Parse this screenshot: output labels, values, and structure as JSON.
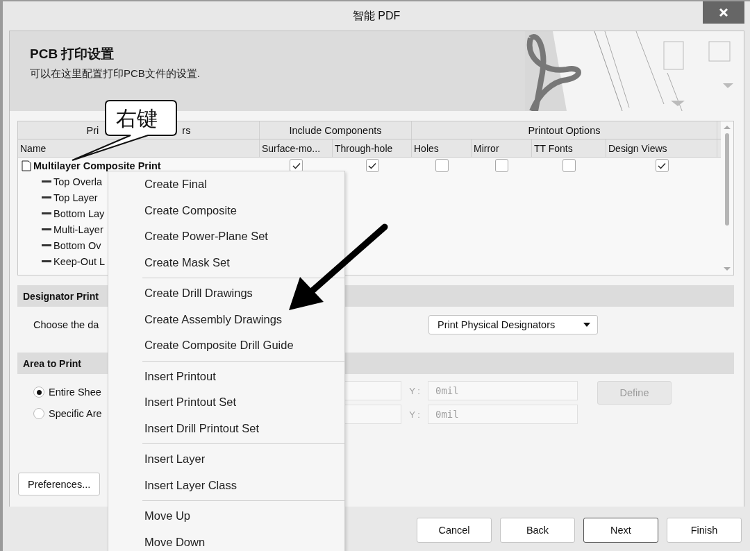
{
  "window": {
    "title": "智能 PDF"
  },
  "header": {
    "title": "PCB 打印设置",
    "subtitle": "可以在这里配置打印PCB文件的设置."
  },
  "callout": {
    "text": "右键"
  },
  "table": {
    "groups": [
      {
        "parts": [
          "Pri",
          "rs"
        ]
      },
      {
        "parts": [
          "Include Components"
        ]
      },
      {
        "parts": [
          "Printout Options"
        ]
      }
    ],
    "columns": [
      "Name",
      "Surface-mo...",
      "Through-hole",
      "Holes",
      "Mirror",
      "TT Fonts",
      "Design Views"
    ],
    "rows": [
      {
        "name": "Multilayer Composite Print",
        "checks": [
          true,
          true,
          false,
          false,
          false,
          true
        ],
        "children": [
          {
            "name": "Top Overla"
          },
          {
            "name": "Top Layer"
          },
          {
            "name": "Bottom Lay"
          },
          {
            "name": "Multi-Layer"
          },
          {
            "name": "Bottom Ov"
          },
          {
            "name": "Keep-Out L"
          }
        ]
      }
    ]
  },
  "designator": {
    "title": "Designator Print",
    "prompt": "Choose the da",
    "dropdown": "Print Physical Designators"
  },
  "area": {
    "title": "Area to Print",
    "options": [
      {
        "label": "Entire Shee",
        "selected": true
      },
      {
        "label": "Specific Are",
        "selected": false
      }
    ],
    "coords": [
      {
        "y_label": "Y :",
        "y_value": "0mil",
        "disabled": true
      },
      {
        "y_label": "Y :",
        "y_value": "0mil",
        "disabled": true
      }
    ],
    "define": {
      "label": "Define",
      "disabled": true
    }
  },
  "preferences": "Preferences...",
  "buttons": [
    {
      "label": "Cancel",
      "default": false
    },
    {
      "label": "Back",
      "default": false
    },
    {
      "label": "Next",
      "default": true
    },
    {
      "label": "Finish",
      "default": false
    }
  ],
  "menu": {
    "groups": [
      {
        "items": [
          {
            "label": "Create Final"
          },
          {
            "label": "Create Composite"
          },
          {
            "label": "Create Power-Plane Set"
          },
          {
            "label": "Create Mask Set"
          }
        ]
      },
      {
        "items": [
          {
            "label": "Create Drill Drawings"
          },
          {
            "label": "Create Assembly Drawings"
          },
          {
            "label": "Create Composite Drill Guide"
          }
        ]
      },
      {
        "items": [
          {
            "label": "Insert Printout"
          },
          {
            "label": "Insert Printout Set"
          },
          {
            "label": "Insert Drill Printout Set"
          }
        ]
      },
      {
        "items": [
          {
            "label": "Insert Layer"
          },
          {
            "label": "Insert Layer Class"
          }
        ]
      },
      {
        "items": [
          {
            "label": "Move Up"
          },
          {
            "label": "Move Down"
          }
        ]
      }
    ]
  }
}
